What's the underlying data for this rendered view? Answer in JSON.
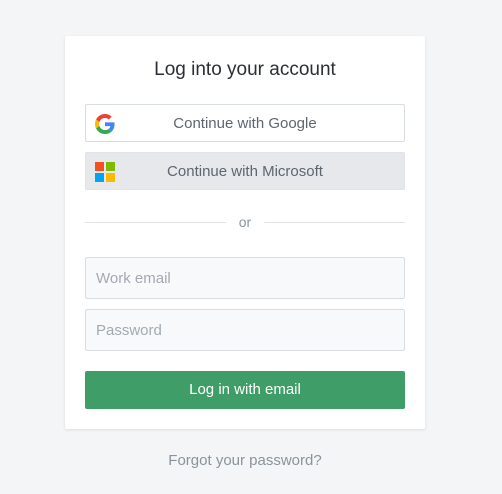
{
  "login": {
    "title": "Log into your account",
    "google_button": {
      "label": "Continue with Google",
      "icon": "google-icon"
    },
    "microsoft_button": {
      "label": "Continue with Microsoft",
      "icon": "microsoft-icon"
    },
    "divider_text": "or",
    "email_field": {
      "placeholder": "Work email",
      "value": ""
    },
    "password_field": {
      "placeholder": "Password",
      "value": ""
    },
    "submit_label": "Log in with email",
    "forgot_password_label": "Forgot your password?"
  },
  "colors": {
    "background": "#f4f5f7",
    "primary_button": "#3f9d67",
    "microsoft_button_bg": "#e6e8eb"
  }
}
